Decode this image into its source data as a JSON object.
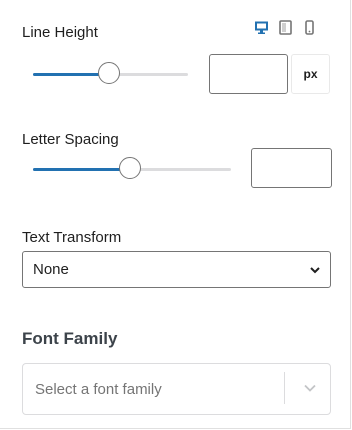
{
  "line_height": {
    "label": "Line Height",
    "unit": "px",
    "value": "",
    "slider_fraction": 0.49
  },
  "letter_spacing": {
    "label": "Letter Spacing",
    "value": "",
    "slider_fraction": 0.49
  },
  "text_transform": {
    "label": "Text Transform",
    "selected": "None"
  },
  "font_family": {
    "label": "Font Family",
    "placeholder": "Select a font family"
  },
  "device_icons": [
    "desktop-icon",
    "tablet-icon",
    "mobile-icon"
  ],
  "colors": {
    "accent": "#2271b1",
    "border": "#757575",
    "track": "#dcdcde"
  }
}
